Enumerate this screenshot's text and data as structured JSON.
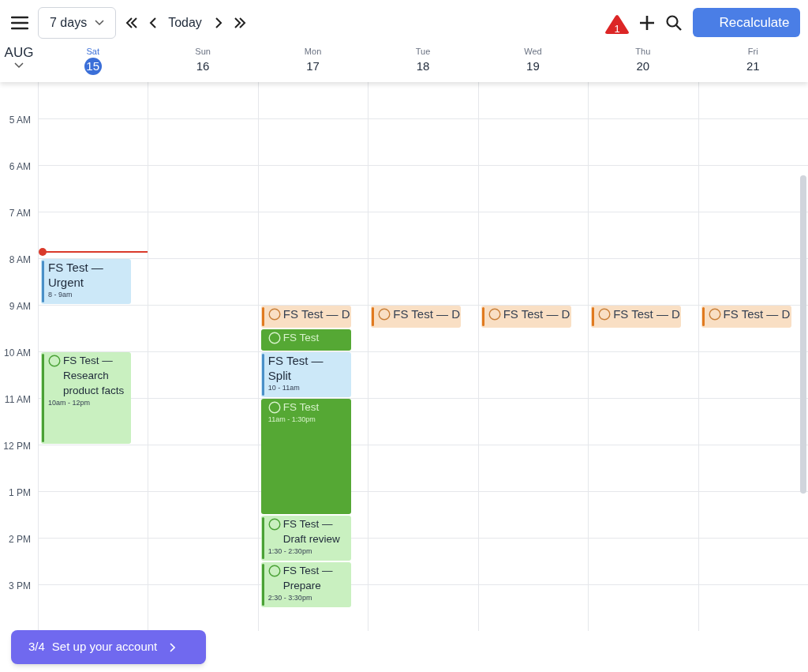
{
  "toolbar": {
    "range": "7 days",
    "today": "Today",
    "alert_count": "1",
    "recalculate": "Recalculate"
  },
  "month": "AUG",
  "days": [
    {
      "weekday": "Sat",
      "date": "15",
      "today": true,
      "events": [
        {
          "kind": "event",
          "title": "FS Test — Urgent",
          "time": "8 - 9am"
        },
        {
          "kind": "task",
          "title": "FS Test — Research product facts",
          "time": "10am - 12pm"
        }
      ]
    },
    {
      "weekday": "Sun",
      "date": "16",
      "today": false
    },
    {
      "weekday": "Mon",
      "date": "17",
      "today": false,
      "events": [
        {
          "kind": "deadline",
          "title": "FS Test — D"
        },
        {
          "kind": "scheduled",
          "title": "FS Test"
        },
        {
          "kind": "event",
          "title": "FS Test — Split",
          "time": "10 - 11am"
        },
        {
          "kind": "scheduled",
          "title": "FS Test",
          "time": "11am - 1:30pm"
        },
        {
          "kind": "task",
          "title": "FS Test — Draft review",
          "time": "1:30 - 2:30pm"
        },
        {
          "kind": "task",
          "title": "FS Test — Prepare",
          "time": "2:30 - 3:30pm"
        }
      ]
    },
    {
      "weekday": "Tue",
      "date": "18",
      "today": false,
      "events": [
        {
          "kind": "deadline",
          "title": "FS Test — D"
        }
      ]
    },
    {
      "weekday": "Wed",
      "date": "19",
      "today": false,
      "events": [
        {
          "kind": "deadline",
          "title": "FS Test — D"
        }
      ]
    },
    {
      "weekday": "Thu",
      "date": "20",
      "today": false,
      "events": [
        {
          "kind": "deadline",
          "title": "FS Test — D"
        }
      ]
    },
    {
      "weekday": "Fri",
      "date": "21",
      "today": false,
      "events": [
        {
          "kind": "deadline",
          "title": "FS Test — D"
        }
      ]
    }
  ],
  "hours": [
    "5 AM",
    "6 AM",
    "7 AM",
    "8 AM",
    "9 AM",
    "10 AM",
    "11 AM",
    "12 PM",
    "1 PM",
    "2 PM",
    "3 PM"
  ],
  "onboarding": {
    "step": "3/4",
    "label": "Set up your account"
  }
}
